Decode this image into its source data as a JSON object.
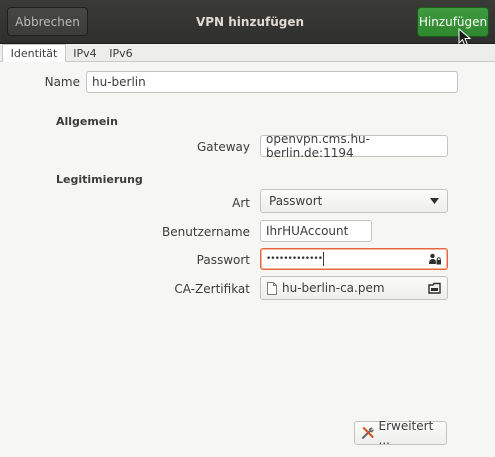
{
  "header": {
    "cancel_label": "Abbrechen",
    "title": "VPN hinzufügen",
    "add_label": "Hinzufügen"
  },
  "tabs": [
    {
      "label": "Identität"
    },
    {
      "label": "IPv4"
    },
    {
      "label": "IPv6"
    }
  ],
  "form": {
    "name_label": "Name",
    "name_value": "hu-berlin",
    "general_section": "Allgemein",
    "gateway_label": "Gateway",
    "gateway_value": "openvpn.cms.hu-berlin.de:1194",
    "auth_section": "Legitimierung",
    "type_label": "Art",
    "type_value": "Passwort",
    "username_label": "Benutzername",
    "username_value": "IhrHUAccount",
    "password_label": "Passwort",
    "password_value": "•••••••••••••",
    "ca_label": "CA-Zertifikat",
    "ca_value": "hu-berlin-ca.pem",
    "advanced_label": "Erweitert ..."
  },
  "colors": {
    "headerbar": "#353533",
    "add_button": "#38923a",
    "focus_border": "#e9663c"
  },
  "icons": {
    "password_menu": "user-lock-icon",
    "ca_file": "file-icon",
    "ca_open": "open-folder-icon",
    "advanced": "tools-icon",
    "type_dropdown": "chevron-down-icon"
  }
}
